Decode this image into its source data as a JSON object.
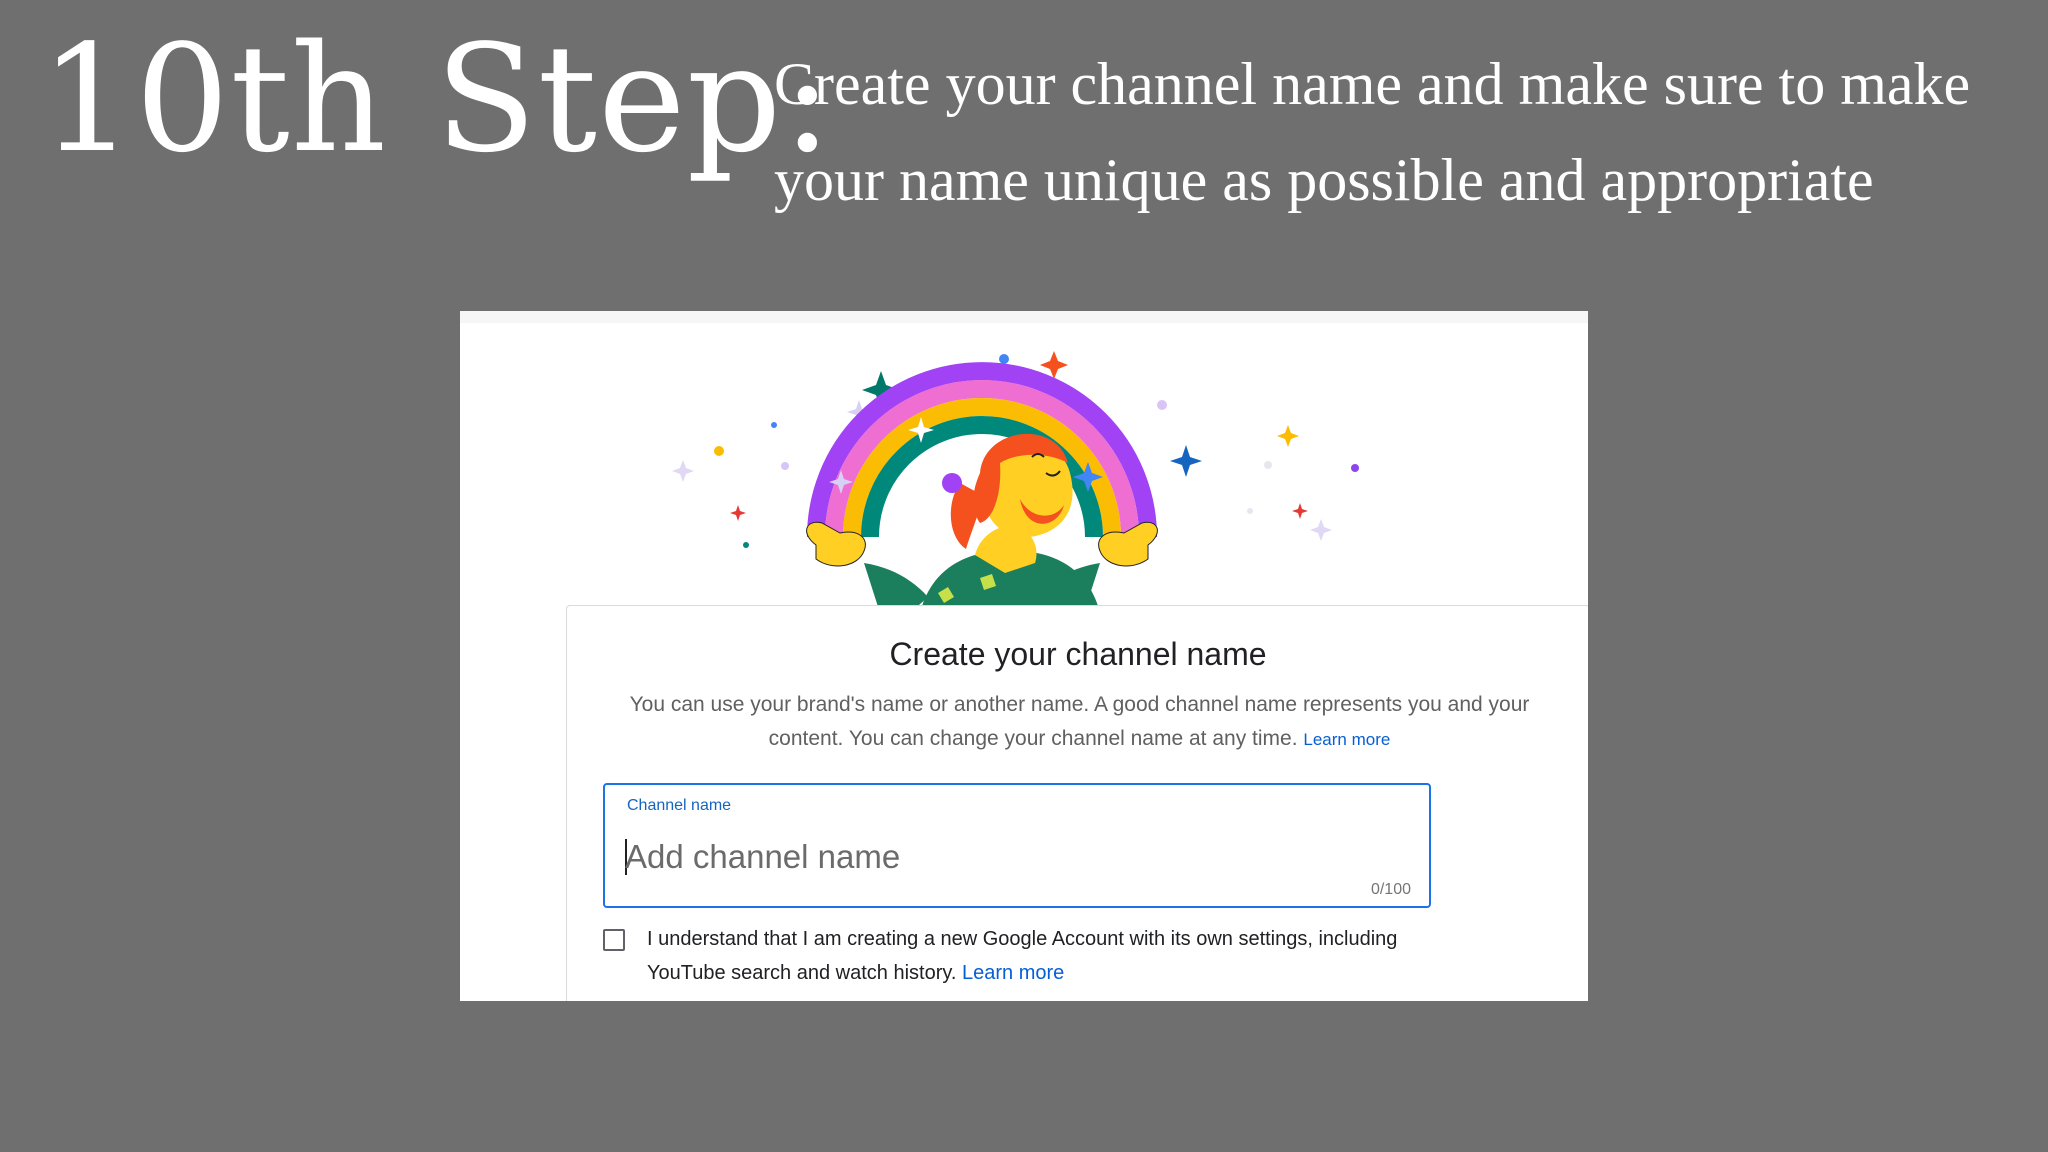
{
  "heading": {
    "step": "10th Step:",
    "description": "Create your channel name and make sure to make your name unique as possible and appropriate"
  },
  "dialog": {
    "illustration": "rainbow-person-icon",
    "title": "Create your channel name",
    "description": "You can use your brand's name or another name. A good channel name represents you and your content. You can change your channel name at any time.",
    "learn_more": "Learn more",
    "field": {
      "label": "Channel name",
      "placeholder": "Add channel name",
      "value": "",
      "counter": "0/100"
    },
    "consent": {
      "checked": false,
      "text": "I understand that I am creating a new Google Account with its own settings, including YouTube search and watch history.",
      "learn_more": "Learn more"
    }
  },
  "colors": {
    "background": "#6f6f70",
    "focus_border": "#1a73e8",
    "link": "#065fd4"
  }
}
